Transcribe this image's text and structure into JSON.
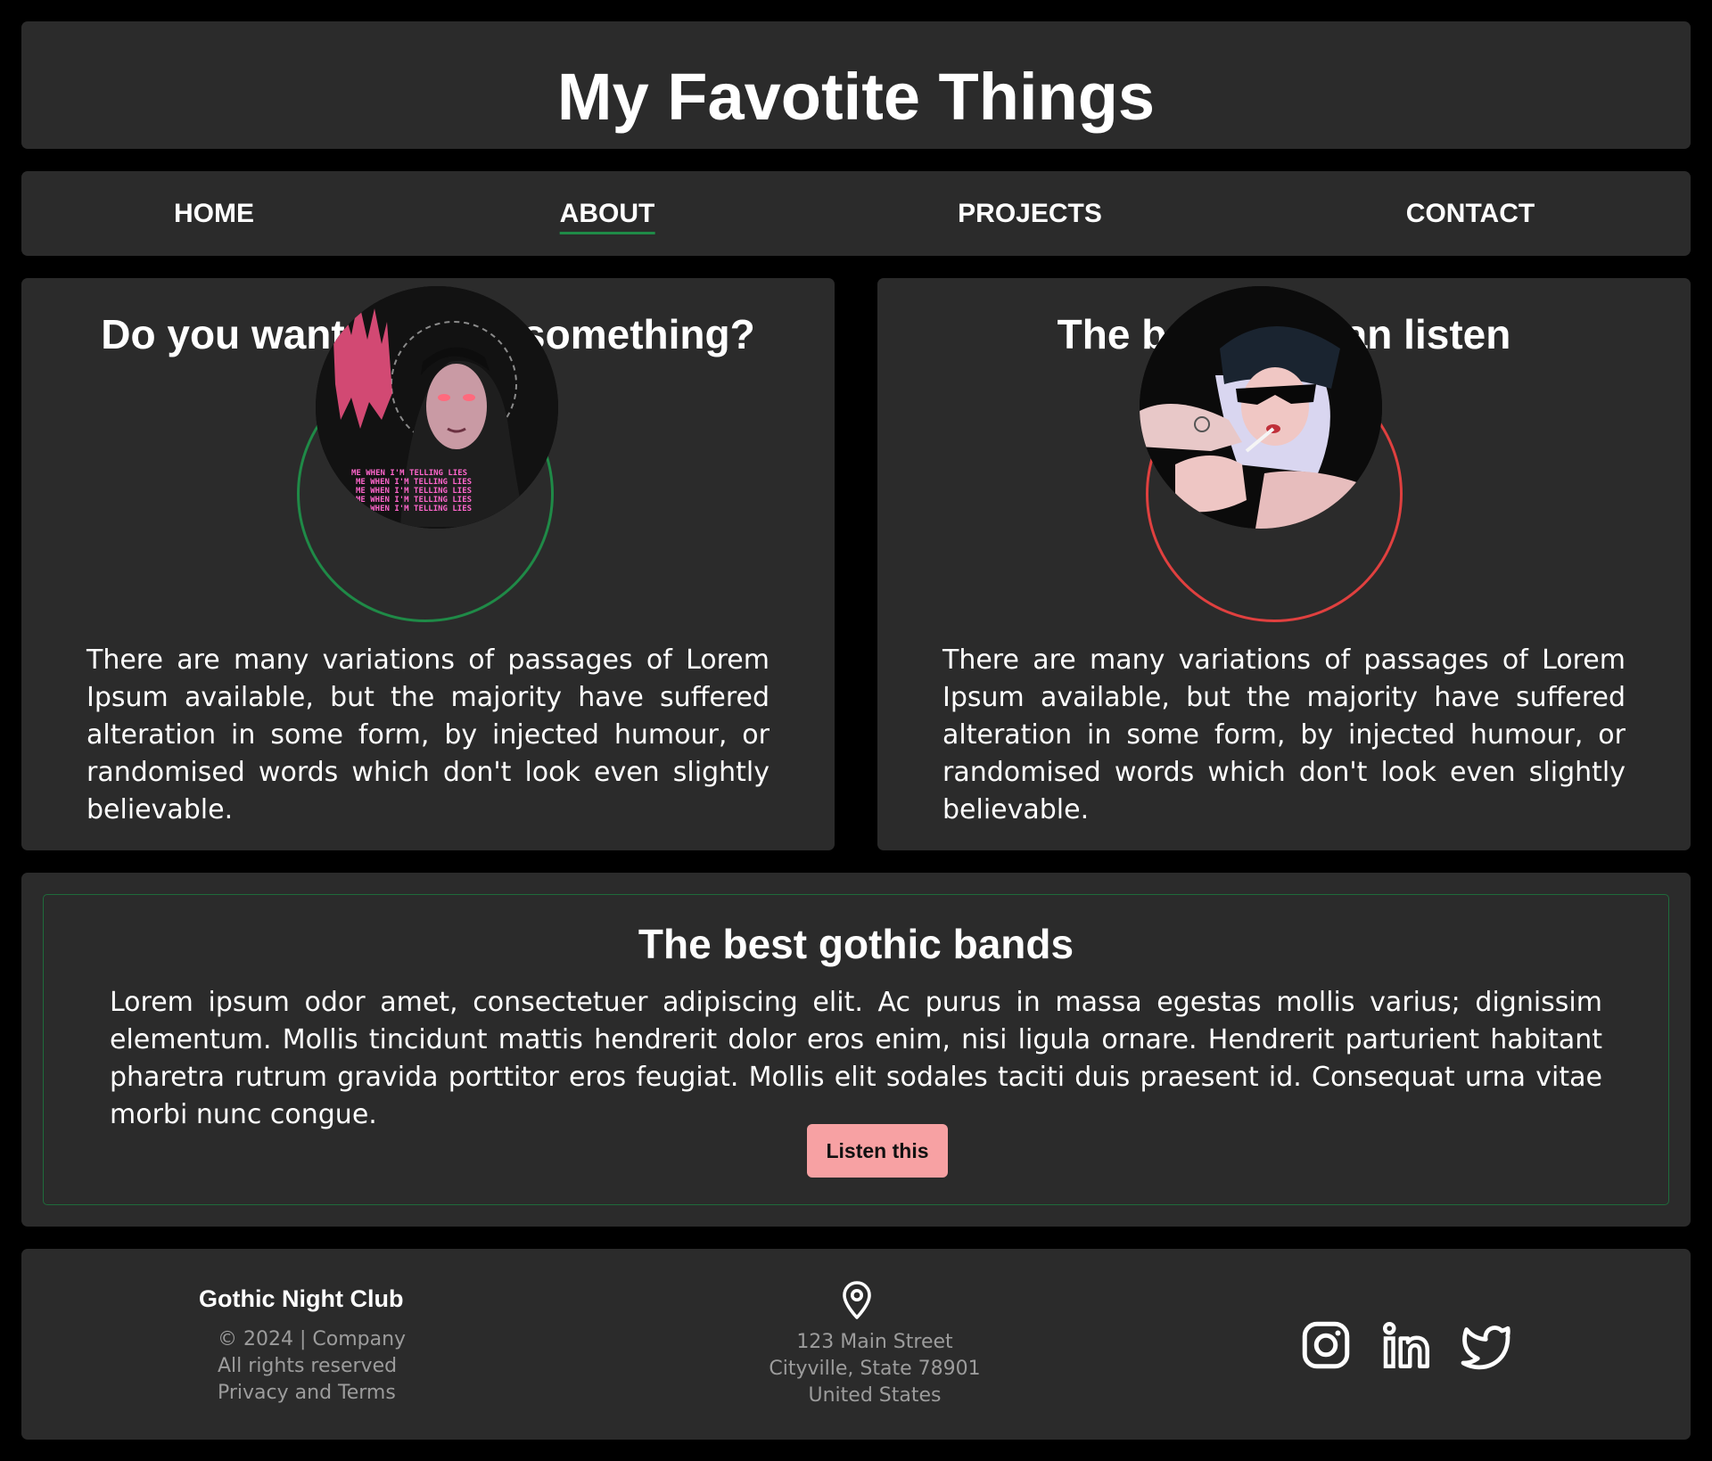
{
  "header": {
    "title": "My Favotite Things"
  },
  "nav": {
    "items": [
      {
        "label": "HOME"
      },
      {
        "label": "ABOUT",
        "active": true
      },
      {
        "label": "PROJECTS"
      },
      {
        "label": "CONTACT"
      }
    ],
    "active_underline_color": "#1f8a47"
  },
  "cards": [
    {
      "title": "Do you want to know something?",
      "image_ring_color": "#1f8a47",
      "image_caption": "ME WHEN I'M TELLING LIES",
      "text": "There are many variations of passages of Lorem Ipsum available, but the majority have suffered alteration in some form, by injected humour, or randomised words which don't look even slightly believable."
    },
    {
      "title": "The best you can listen",
      "image_ring_color": "#e0403f",
      "text": "There are many variations of passages of Lorem Ipsum available, but the majority have suffered alteration in some form, by injected humour, or randomised words which don't look even slightly believable."
    }
  ],
  "bands": {
    "title": "The best gothic bands",
    "text": "Lorem ipsum odor amet, consectetuer adipiscing elit. Ac purus in massa egestas mollis varius; dignissim elementum. Mollis tincidunt mattis hendrerit dolor eros enim, nisi ligula ornare. Hendrerit parturient habitant pharetra rutrum gravida porttitor eros feugiat. Mollis elit sodales taciti duis praesent id. Consequat urna vitae morbi nunc congue.",
    "button_label": "Listen this",
    "button_color": "#f7a1a3"
  },
  "footer": {
    "brand": "Gothic Night Club",
    "lines": [
      "© 2024 | Company",
      "All rights reserved",
      "Privacy and Terms"
    ],
    "address": [
      "123 Main Street",
      "Cityville, State 78901",
      "United States"
    ],
    "icons": [
      "map-pin-icon",
      "instagram-icon",
      "linkedin-icon",
      "twitter-icon"
    ]
  }
}
